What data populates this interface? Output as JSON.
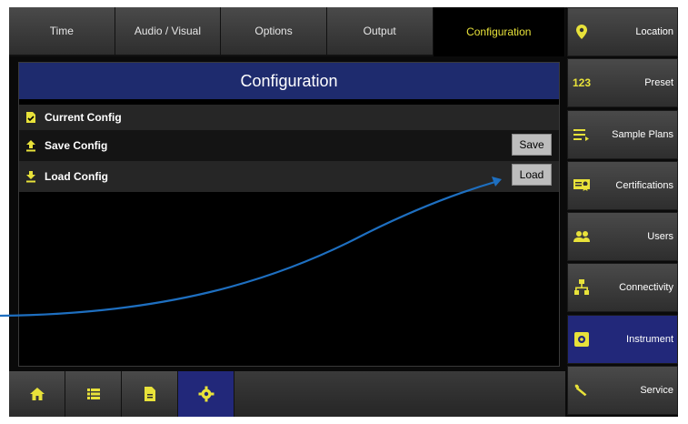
{
  "tabs": [
    {
      "label": "Time"
    },
    {
      "label": "Audio / Visual"
    },
    {
      "label": "Options"
    },
    {
      "label": "Output"
    },
    {
      "label": "Configuration"
    }
  ],
  "panel": {
    "title": "Configuration",
    "rows": [
      {
        "label": "Current Config"
      },
      {
        "label": "Save Config",
        "button": "Save"
      },
      {
        "label": "Load Config",
        "button": "Load"
      }
    ]
  },
  "sidebar": {
    "items": [
      {
        "label": "Location",
        "icon": "location-pin-icon"
      },
      {
        "label": "Preset",
        "icon": "preset-123-icon",
        "icon_text": "123"
      },
      {
        "label": "Sample Plans",
        "icon": "sample-plans-icon"
      },
      {
        "label": "Certifications",
        "icon": "certificate-icon"
      },
      {
        "label": "Users",
        "icon": "users-icon"
      },
      {
        "label": "Connectivity",
        "icon": "network-icon"
      },
      {
        "label": "Instrument",
        "icon": "instrument-gear-icon"
      },
      {
        "label": "Service",
        "icon": "wrench-icon"
      }
    ]
  },
  "bottom_bar": [
    "home-icon",
    "list-icon",
    "document-icon",
    "gear-icon"
  ],
  "colors": {
    "accent": "#e8e23a",
    "active_blue": "#22287a",
    "title_blue": "#1e2b6e",
    "arrow": "#1e6fc0"
  }
}
